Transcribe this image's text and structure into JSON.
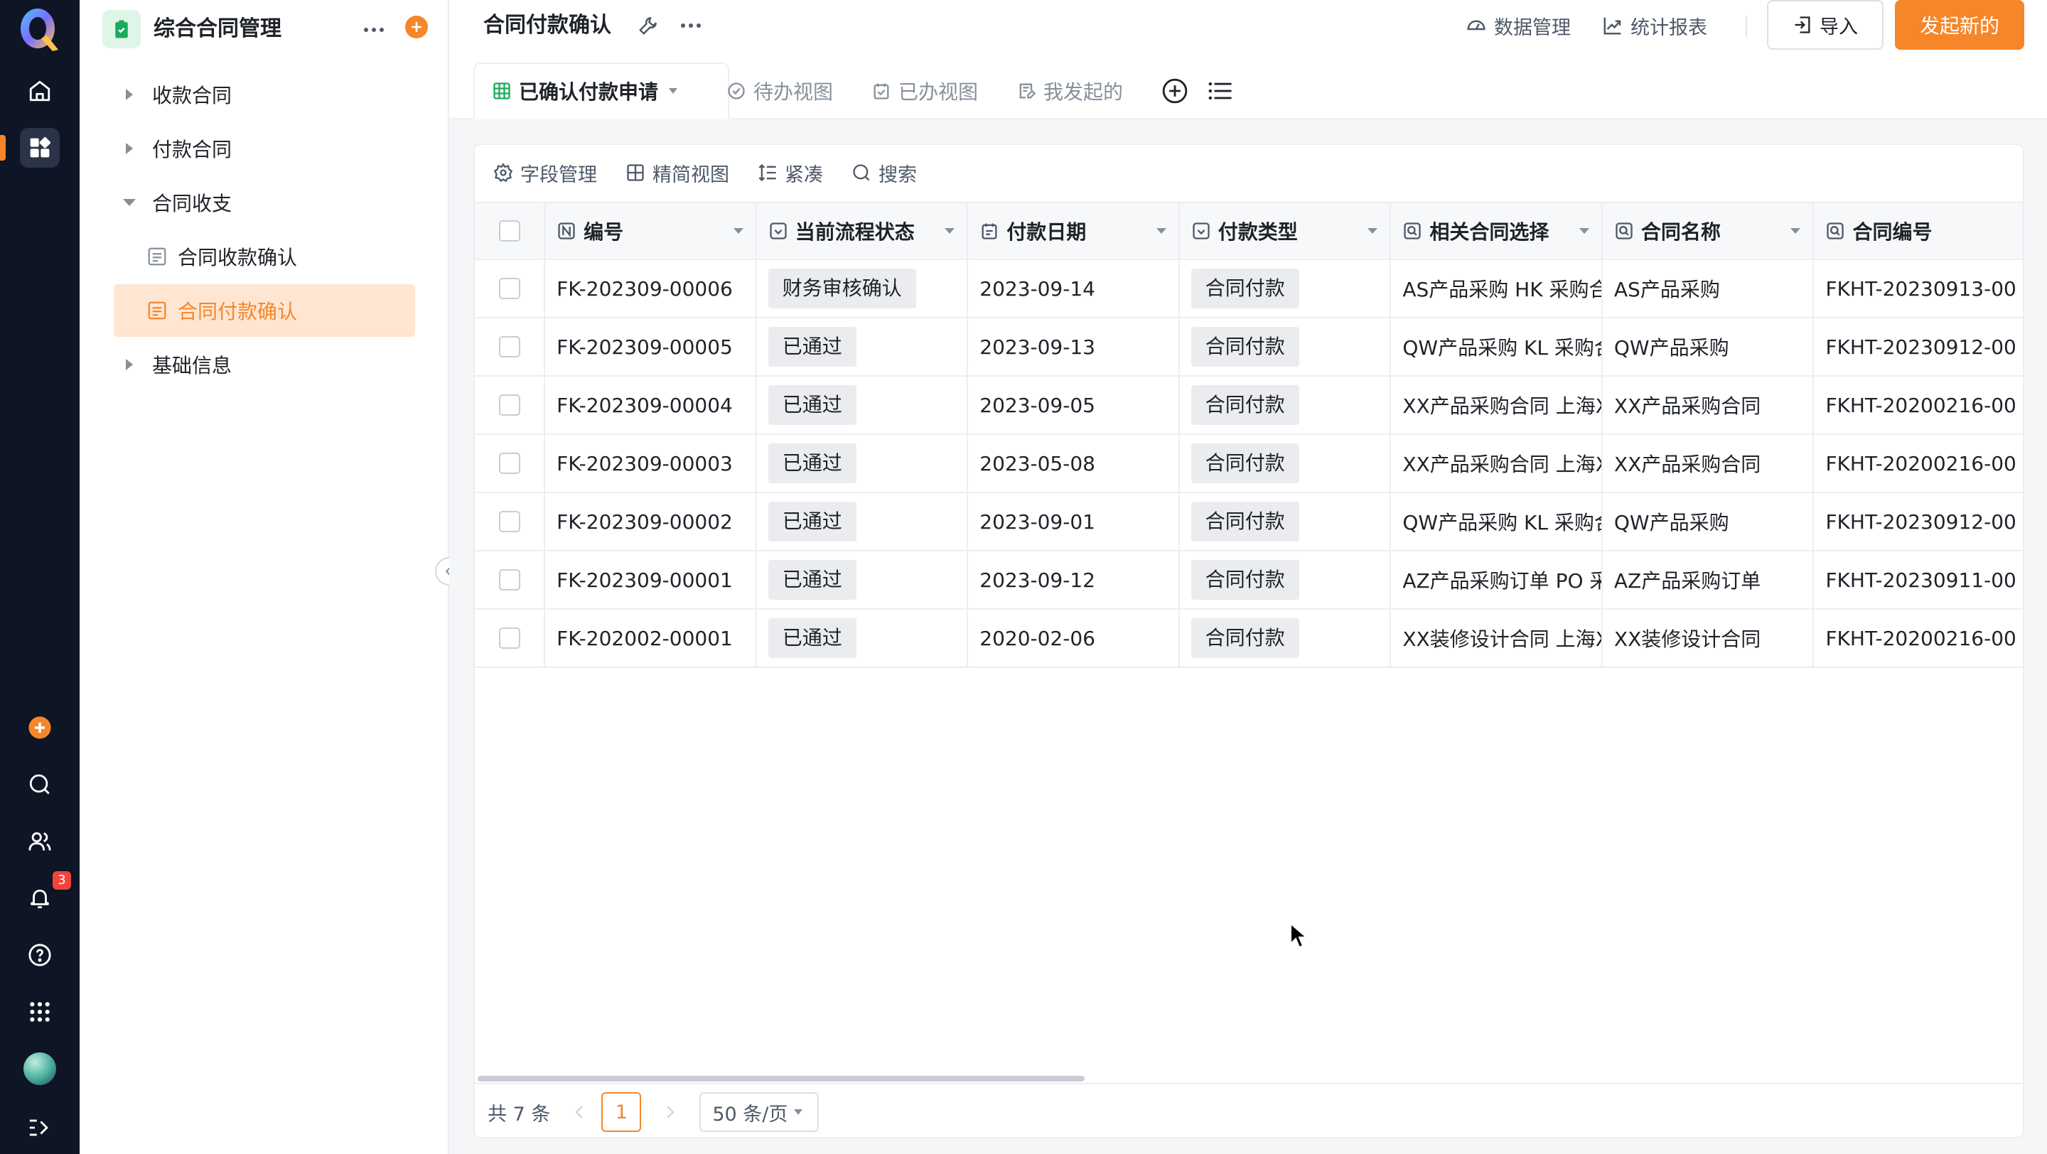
{
  "rail": {
    "logo_letter": "Q",
    "notification_count": "3",
    "colors": {
      "bg": "#0e1525",
      "accent": "#f5862a"
    }
  },
  "sidebar": {
    "app_title": "综合合同管理",
    "tree": [
      {
        "label": "收款合同",
        "expanded": false
      },
      {
        "label": "付款合同",
        "expanded": false
      },
      {
        "label": "合同收支",
        "expanded": true
      },
      {
        "label": "合同收款确认",
        "child": true
      },
      {
        "label": "合同付款确认",
        "child": true,
        "active": true
      },
      {
        "label": "基础信息",
        "expanded": false
      }
    ]
  },
  "topbar": {
    "title": "合同付款确认",
    "data_manage": "数据管理",
    "stats_report": "统计报表",
    "import": "导入",
    "create_new": "发起新的"
  },
  "view_tabs": {
    "active": "已确认付款申请",
    "todo": "待办视图",
    "done": "已办视图",
    "mine": "我发起的"
  },
  "toolbar": {
    "fields": "字段管理",
    "compact_view": "精简视图",
    "dense": "紧凑",
    "search": "搜索"
  },
  "table": {
    "columns": [
      "编号",
      "当前流程状态",
      "付款日期",
      "付款类型",
      "相关合同选择",
      "合同名称",
      "合同编号"
    ],
    "rows": [
      {
        "id": "FK-202309-00006",
        "status": "财务审核确认",
        "date": "2023-09-14",
        "type": "合同付款",
        "related": "AS产品采购 HK 采购合",
        "name": "AS产品采购",
        "code": "FKHT-20230913-00"
      },
      {
        "id": "FK-202309-00005",
        "status": "已通过",
        "date": "2023-09-13",
        "type": "合同付款",
        "related": "QW产品采购 KL 采购合",
        "name": "QW产品采购",
        "code": "FKHT-20230912-00"
      },
      {
        "id": "FK-202309-00004",
        "status": "已通过",
        "date": "2023-09-05",
        "type": "合同付款",
        "related": "XX产品采购合同 上海X",
        "name": "XX产品采购合同",
        "code": "FKHT-20200216-00"
      },
      {
        "id": "FK-202309-00003",
        "status": "已通过",
        "date": "2023-05-08",
        "type": "合同付款",
        "related": "XX产品采购合同 上海X",
        "name": "XX产品采购合同",
        "code": "FKHT-20200216-00"
      },
      {
        "id": "FK-202309-00002",
        "status": "已通过",
        "date": "2023-09-01",
        "type": "合同付款",
        "related": "QW产品采购 KL 采购合",
        "name": "QW产品采购",
        "code": "FKHT-20230912-00"
      },
      {
        "id": "FK-202309-00001",
        "status": "已通过",
        "date": "2023-09-12",
        "type": "合同付款",
        "related": "AZ产品采购订单 PO 采",
        "name": "AZ产品采购订单",
        "code": "FKHT-20230911-00"
      },
      {
        "id": "FK-202002-00001",
        "status": "已通过",
        "date": "2020-02-06",
        "type": "合同付款",
        "related": "XX装修设计合同 上海X",
        "name": "XX装修设计合同",
        "code": "FKHT-20200216-00"
      }
    ]
  },
  "pager": {
    "total": "共 7 条",
    "current_page": "1",
    "page_size": "50 条/页"
  }
}
